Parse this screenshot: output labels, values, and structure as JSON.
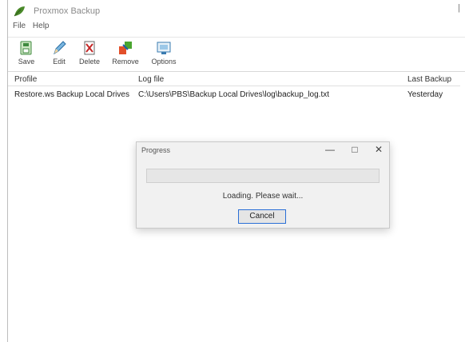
{
  "window": {
    "title": "Proxmox Backup"
  },
  "menu": [
    "File",
    "Help"
  ],
  "toolbar": [
    {
      "label": "Save",
      "icon": "save-icon"
    },
    {
      "label": "Edit",
      "icon": "edit-icon"
    },
    {
      "label": "Delete",
      "icon": "delete-icon"
    },
    {
      "label": "Remove",
      "icon": "remove-icon"
    },
    {
      "label": "Options",
      "icon": "options-icon"
    }
  ],
  "table": {
    "headers": [
      "Profile",
      "Log file",
      "Last Backup"
    ],
    "rows": [
      [
        "Restore.ws Backup Local Drives",
        "C:\\Users\\PBS\\Backup Local Drives\\log\\backup_log.txt",
        "Yesterday"
      ]
    ]
  },
  "dialog": {
    "title": "Progress",
    "controls": [
      "—",
      "□",
      "✕"
    ],
    "progress": 0,
    "status": "Loading. Please wait...",
    "cancel_label": "Cancel"
  }
}
